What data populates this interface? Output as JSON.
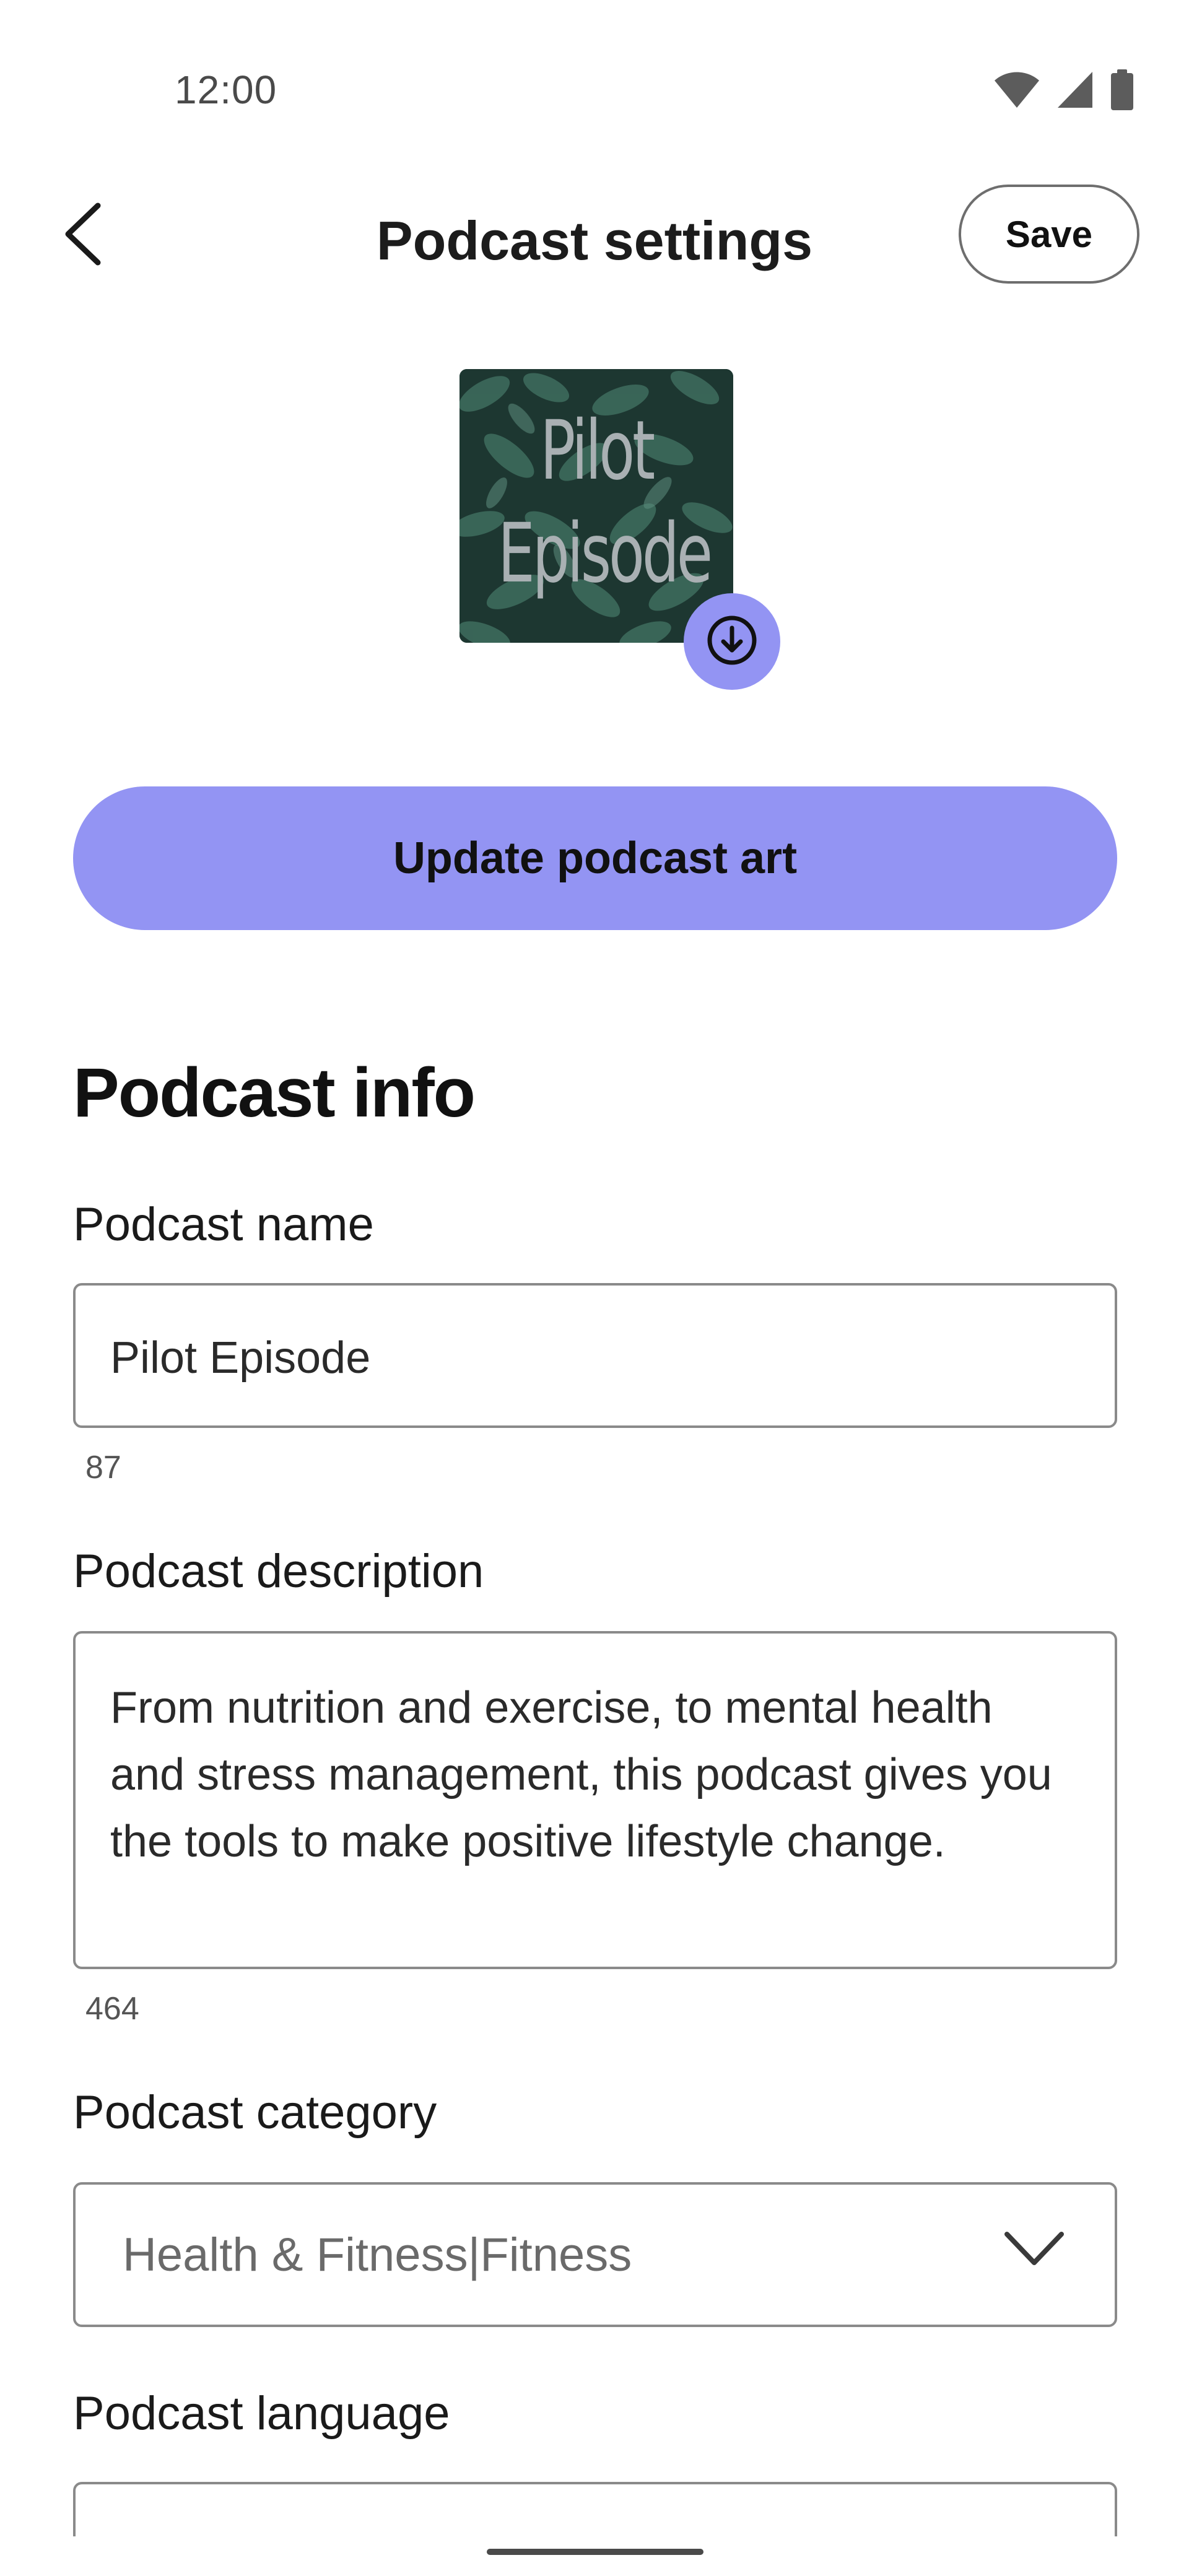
{
  "status_bar": {
    "time": "12:00",
    "icons": [
      "wifi-icon",
      "signal-icon",
      "battery-icon"
    ]
  },
  "header": {
    "title": "Podcast settings",
    "save_label": "Save"
  },
  "art": {
    "line1": "Pilot",
    "line2": "Episode"
  },
  "update_button_label": "Update podcast art",
  "section_title": "Podcast info",
  "fields": {
    "name": {
      "label": "Podcast name",
      "value": "Pilot Episode",
      "count": "87"
    },
    "description": {
      "label": "Podcast description",
      "value": "From nutrition and exercise, to mental health and stress management, this podcast gives you the tools to make positive lifestyle change.",
      "count": "464"
    },
    "category": {
      "label": "Podcast category",
      "value": "Health & Fitness|Fitness"
    },
    "language": {
      "label": "Podcast language"
    }
  },
  "colors": {
    "accent": "#9394f3",
    "border": "#8a8a8a",
    "text": "#111111"
  }
}
